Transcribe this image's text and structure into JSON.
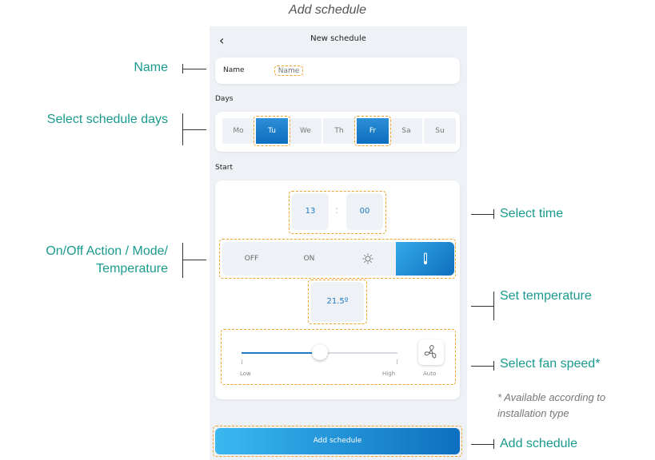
{
  "caption": "Add schedule",
  "header": {
    "back_icon": "chevron-left-icon",
    "title": "New schedule"
  },
  "name_section": {
    "label": "Name",
    "placeholder": "Name"
  },
  "days_section": {
    "label": "Days",
    "days": [
      {
        "label": "Mo",
        "selected": false
      },
      {
        "label": "Tu",
        "selected": true
      },
      {
        "label": "We",
        "selected": false
      },
      {
        "label": "Th",
        "selected": false
      },
      {
        "label": "Fr",
        "selected": true
      },
      {
        "label": "Sa",
        "selected": false
      },
      {
        "label": "Su",
        "selected": false
      }
    ]
  },
  "start_section": {
    "label": "Start",
    "hour": "13",
    "separator": ":",
    "minute": "00",
    "modes": [
      {
        "label": "OFF",
        "icon": "",
        "selected": false
      },
      {
        "label": "ON",
        "icon": "",
        "selected": false
      },
      {
        "label": "",
        "icon": "sun-icon",
        "selected": false
      },
      {
        "label": "",
        "icon": "thermometer-icon",
        "selected": true
      }
    ],
    "temperature": "21.5º",
    "fan": {
      "low_label": "Low",
      "high_label": "High",
      "auto_label": "Auto",
      "level": 0.5,
      "icon": "fan-icon"
    }
  },
  "add_button_label": "Add schedule",
  "annotations": {
    "name": "Name",
    "days": "Select schedule days",
    "action": "On/Off Action / Mode/ Temperature",
    "time": "Select time",
    "temperature": "Set temperature",
    "fan": "Select fan speed*",
    "note": "* Available according to installation type",
    "add": "Add schedule"
  },
  "colors": {
    "accent": "#1e7bc7",
    "annotation": "#1a9a8e",
    "highlight": "#f0a22e"
  }
}
